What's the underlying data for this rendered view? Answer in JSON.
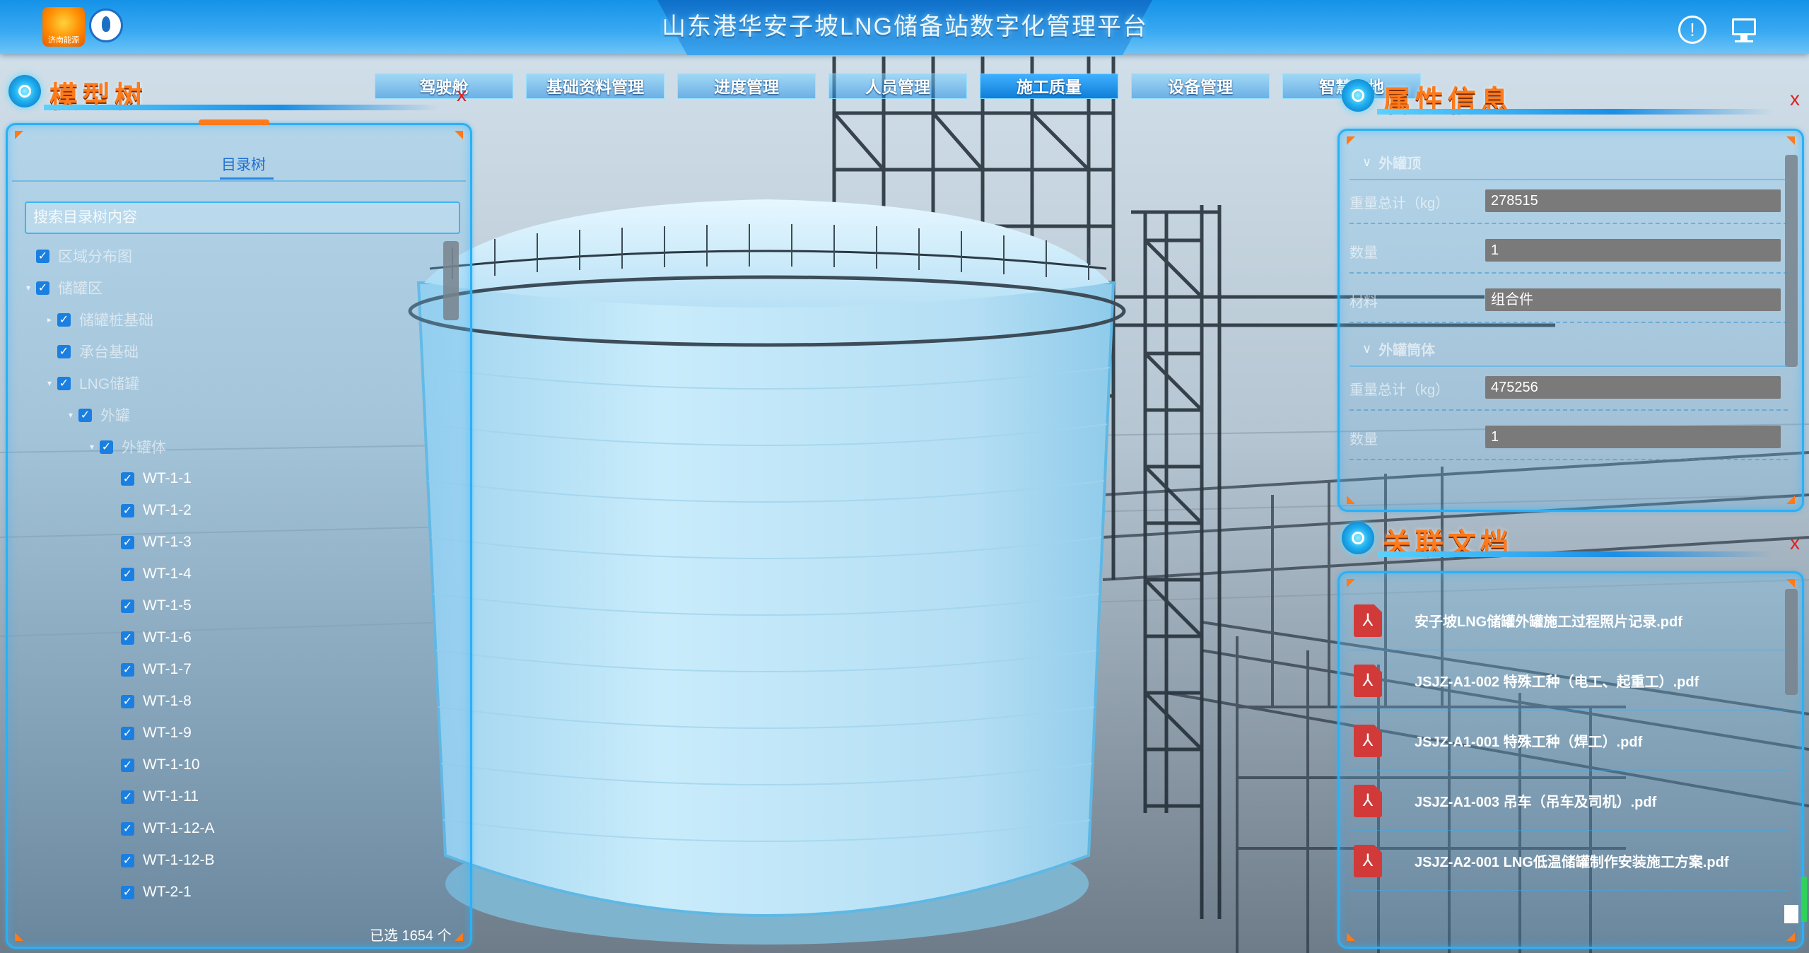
{
  "app": {
    "title": "山东港华安子坡LNG储备站数字化管理平台",
    "logo_text": "济南能源"
  },
  "header_icons": [
    "alert-circle-icon",
    "monitor-icon"
  ],
  "nav": {
    "tabs": [
      {
        "label": "驾驶舱"
      },
      {
        "label": "基础资料管理"
      },
      {
        "label": "进度管理"
      },
      {
        "label": "人员管理"
      },
      {
        "label": "施工质量",
        "active": true
      },
      {
        "label": "设备管理"
      },
      {
        "label": "智慧工地"
      }
    ]
  },
  "model_tree": {
    "title": "模型树",
    "tab_label": "目录树",
    "search_placeholder": "搜索目录树内容",
    "items": [
      {
        "label": "区域分布图",
        "level": 0,
        "caret": "",
        "faint": true
      },
      {
        "label": "储罐区",
        "level": 0,
        "caret": "▾",
        "faint": true
      },
      {
        "label": "储罐桩基础",
        "level": 1,
        "caret": "▸",
        "faint": true
      },
      {
        "label": "承台基础",
        "level": 1,
        "caret": "",
        "faint": true
      },
      {
        "label": "LNG储罐",
        "level": 1,
        "caret": "▾",
        "faint": true
      },
      {
        "label": "外罐",
        "level": 2,
        "caret": "▾",
        "faint": true
      },
      {
        "label": "外罐体",
        "level": 3,
        "caret": "▾",
        "faint": true
      },
      {
        "label": "WT-1-1",
        "level": 4,
        "caret": ""
      },
      {
        "label": "WT-1-2",
        "level": 4,
        "caret": ""
      },
      {
        "label": "WT-1-3",
        "level": 4,
        "caret": ""
      },
      {
        "label": "WT-1-4",
        "level": 4,
        "caret": ""
      },
      {
        "label": "WT-1-5",
        "level": 4,
        "caret": ""
      },
      {
        "label": "WT-1-6",
        "level": 4,
        "caret": ""
      },
      {
        "label": "WT-1-7",
        "level": 4,
        "caret": ""
      },
      {
        "label": "WT-1-8",
        "level": 4,
        "caret": ""
      },
      {
        "label": "WT-1-9",
        "level": 4,
        "caret": ""
      },
      {
        "label": "WT-1-10",
        "level": 4,
        "caret": ""
      },
      {
        "label": "WT-1-11",
        "level": 4,
        "caret": ""
      },
      {
        "label": "WT-1-12-A",
        "level": 4,
        "caret": ""
      },
      {
        "label": "WT-1-12-B",
        "level": 4,
        "caret": ""
      },
      {
        "label": "WT-2-1",
        "level": 4,
        "caret": ""
      }
    ],
    "selected_count": "已选 1654 个"
  },
  "attributes": {
    "title": "属性信息",
    "close": "x",
    "sections": [
      {
        "name": "外罐顶",
        "rows": [
          {
            "key": "重量总计（kg）",
            "value": "278515"
          },
          {
            "key": "数量",
            "value": "1"
          },
          {
            "key": "材料",
            "value": "组合件"
          }
        ]
      },
      {
        "name": "外罐筒体",
        "rows": [
          {
            "key": "重量总计（kg）",
            "value": "475256"
          },
          {
            "key": "数量",
            "value": "1"
          }
        ]
      }
    ]
  },
  "documents": {
    "title": "关联文档",
    "close": "x",
    "files": [
      {
        "name": "安子坡LNG储罐外罐施工过程照片记录.pdf"
      },
      {
        "name": "JSJZ-A1-002 特殊工种（电工、起重工）.pdf"
      },
      {
        "name": "JSJZ-A1-001 特殊工种（焊工）.pdf"
      },
      {
        "name": "JSJZ-A1-003 吊车（吊车及司机）.pdf"
      },
      {
        "name": "JSJZ-A2-001 LNG低温储罐制作安装施工方案.pdf"
      }
    ]
  },
  "colors": {
    "accent_orange": "#ff7a1a",
    "panel_border": "#2bb0f5",
    "header_blue": "#1592e8",
    "checkbox_blue": "#1a7fe0",
    "close_red": "#e02020",
    "pdf_red": "#d23a3a"
  }
}
